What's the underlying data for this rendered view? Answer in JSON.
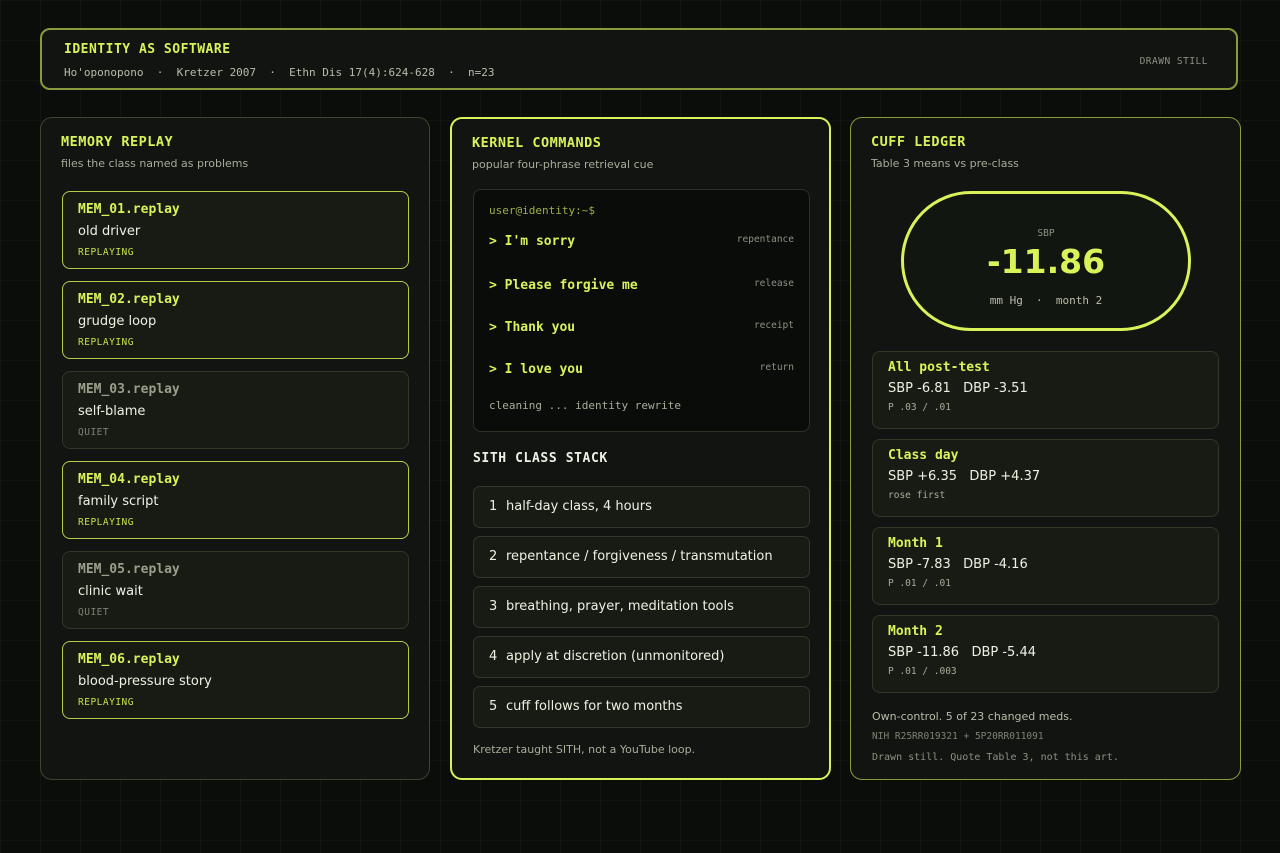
{
  "header": {
    "title": "IDENTITY AS SOFTWARE",
    "meta": "Ho'oponopono  ·  Kretzer 2007  ·  Ethn Dis 17(4):624-628  ·  n=23",
    "right_label": "DRAWN STILL"
  },
  "memory": {
    "title": "MEMORY REPLAY",
    "subtitle": "files the class named as problems",
    "items": [
      {
        "name": "MEM_01.replay",
        "label": "old driver",
        "status": "REPLAYING"
      },
      {
        "name": "MEM_02.replay",
        "label": "grudge loop",
        "status": "REPLAYING"
      },
      {
        "name": "MEM_03.replay",
        "label": "self-blame",
        "status": "QUIET"
      },
      {
        "name": "MEM_04.replay",
        "label": "family script",
        "status": "REPLAYING"
      },
      {
        "name": "MEM_05.replay",
        "label": "clinic wait",
        "status": "QUIET"
      },
      {
        "name": "MEM_06.replay",
        "label": "blood-pressure story",
        "status": "REPLAYING"
      }
    ]
  },
  "kernel": {
    "title": "KERNEL COMMANDS",
    "subtitle": "popular four-phrase retrieval cue",
    "prompt": "user@identity:~$",
    "commands": [
      {
        "text": "> I'm sorry",
        "tag": "repentance"
      },
      {
        "text": "> Please forgive me",
        "tag": "release"
      },
      {
        "text": "> Thank you",
        "tag": "receipt"
      },
      {
        "text": "> I love you",
        "tag": "return"
      }
    ],
    "footer": "cleaning ... identity rewrite",
    "stack_title": "SITH CLASS STACK",
    "steps": [
      {
        "num": "1",
        "text": "half-day class, 4 hours"
      },
      {
        "num": "2",
        "text": "repentance / forgiveness / transmutation"
      },
      {
        "num": "3",
        "text": "breathing, prayer, meditation tools"
      },
      {
        "num": "4",
        "text": "apply at discretion (unmonitored)"
      },
      {
        "num": "5",
        "text": "cuff follows for two months"
      }
    ],
    "note": "Kretzer taught SITH, not a YouTube loop."
  },
  "cuff": {
    "title": "CUFF LEDGER",
    "subtitle": "Table 3 means vs pre-class",
    "pill": {
      "label": "SBP",
      "value": "-11.86",
      "unit": "mm Hg  ·  month 2"
    },
    "rows": [
      {
        "title": "All post-test",
        "values": "SBP -6.81   DBP -3.51",
        "p": "P .03 / .01"
      },
      {
        "title": "Class day",
        "values": "SBP +6.35   DBP +4.37",
        "p": "rose first"
      },
      {
        "title": "Month 1",
        "values": "SBP -7.83   DBP -4.16",
        "p": "P .01 / .01"
      },
      {
        "title": "Month 2",
        "values": "SBP -11.86   DBP -5.44",
        "p": "P .01 / .003"
      }
    ],
    "foot1": "Own-control. 5 of 23 changed meds.",
    "foot2": "NIH R25RR019321 + 5P20RR011091",
    "foot3": "Drawn still. Quote Table 3, not this art."
  },
  "colors": {
    "accent": "#d9f25a",
    "active_border": "#b6cc48",
    "background": "#0b0d0a"
  }
}
